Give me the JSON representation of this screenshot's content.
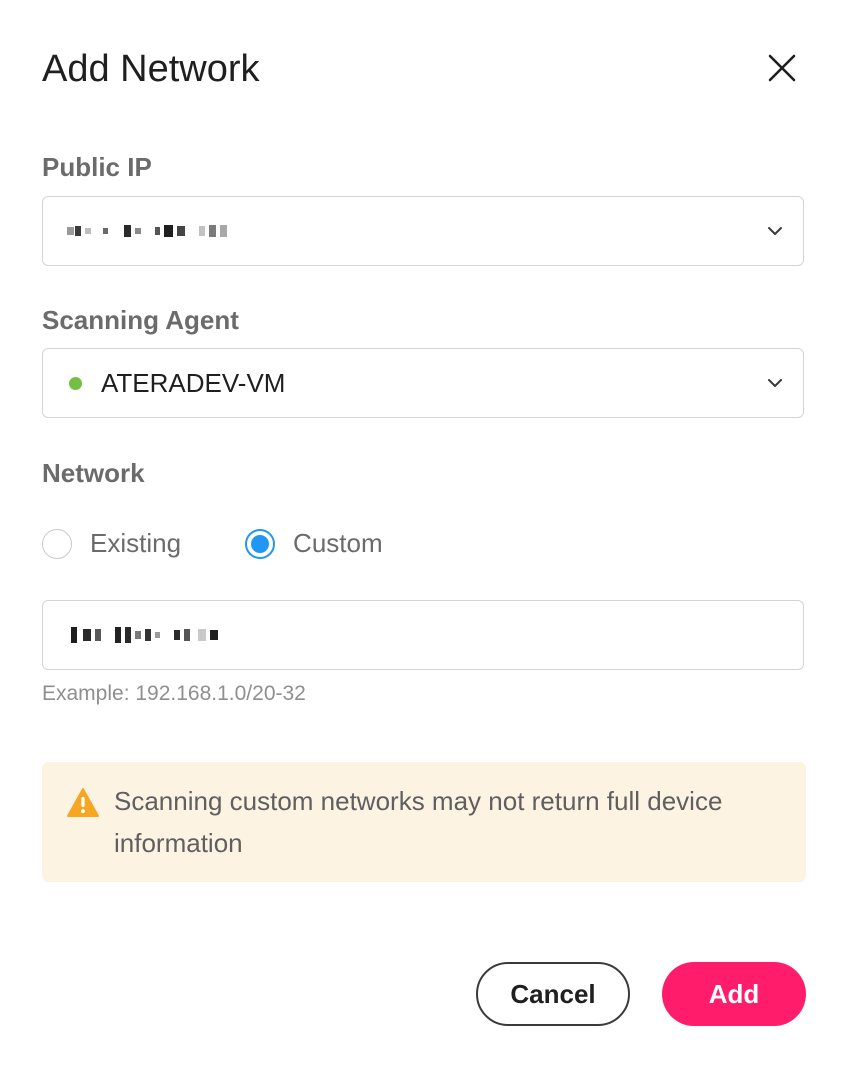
{
  "dialog": {
    "title": "Add Network"
  },
  "public_ip": {
    "label": "Public IP",
    "value_redacted": true
  },
  "scanning_agent": {
    "label": "Scanning Agent",
    "value": "ATERADEV-VM",
    "status_color": "#72bf44"
  },
  "network": {
    "label": "Network",
    "options": [
      {
        "label": "Existing",
        "selected": false
      },
      {
        "label": "Custom",
        "selected": true
      }
    ],
    "value_redacted": true,
    "hint": "Example: 192.168.1.0/20-32"
  },
  "warning": {
    "icon": "warning-triangle-icon",
    "text": "Scanning custom networks may not return full device information"
  },
  "actions": {
    "cancel_label": "Cancel",
    "add_label": "Add"
  },
  "colors": {
    "accent_radio": "#2196f3",
    "primary_button": "#ff1c6b",
    "warning_bg": "#fdf3e3",
    "warning_icon": "#f5a623"
  }
}
